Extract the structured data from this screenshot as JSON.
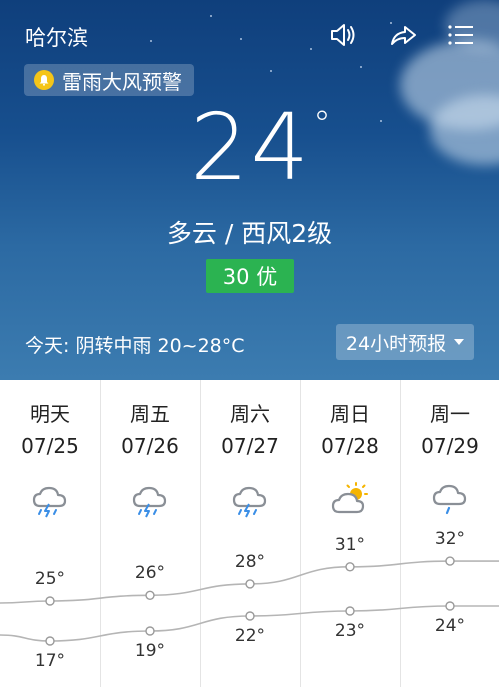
{
  "header": {
    "city": "哈尔滨",
    "alert": "雷雨大风预警",
    "temperature": "24",
    "degree_symbol": "°",
    "condition": "多云 / 西风2级",
    "aqi": "30 优",
    "today": "今天:  阴转中雨   20~28°C",
    "forecast_button": "24小时预报"
  },
  "forecast": [
    {
      "day": "明天",
      "date": "07/25",
      "icon": "thunderstorm-icon",
      "high": "25°",
      "low": "17°",
      "high_value": 25,
      "low_value": 17
    },
    {
      "day": "周五",
      "date": "07/26",
      "icon": "thunderstorm-icon",
      "high": "26°",
      "low": "19°",
      "high_value": 26,
      "low_value": 19
    },
    {
      "day": "周六",
      "date": "07/27",
      "icon": "thunderstorm-icon",
      "high": "28°",
      "low": "22°",
      "high_value": 28,
      "low_value": 22
    },
    {
      "day": "周日",
      "date": "07/28",
      "icon": "partly-cloudy-icon",
      "high": "31°",
      "low": "23°",
      "high_value": 31,
      "low_value": 23
    },
    {
      "day": "周一",
      "date": "07/29",
      "icon": "light-rain-icon",
      "high": "32°",
      "low": "24°",
      "high_value": 32,
      "low_value": 24
    }
  ],
  "colors": {
    "aqi_good": "#2bb351",
    "alert_bell": "#f5c518",
    "sun": "#f5b400",
    "rain_drop": "#3a8ee6"
  }
}
